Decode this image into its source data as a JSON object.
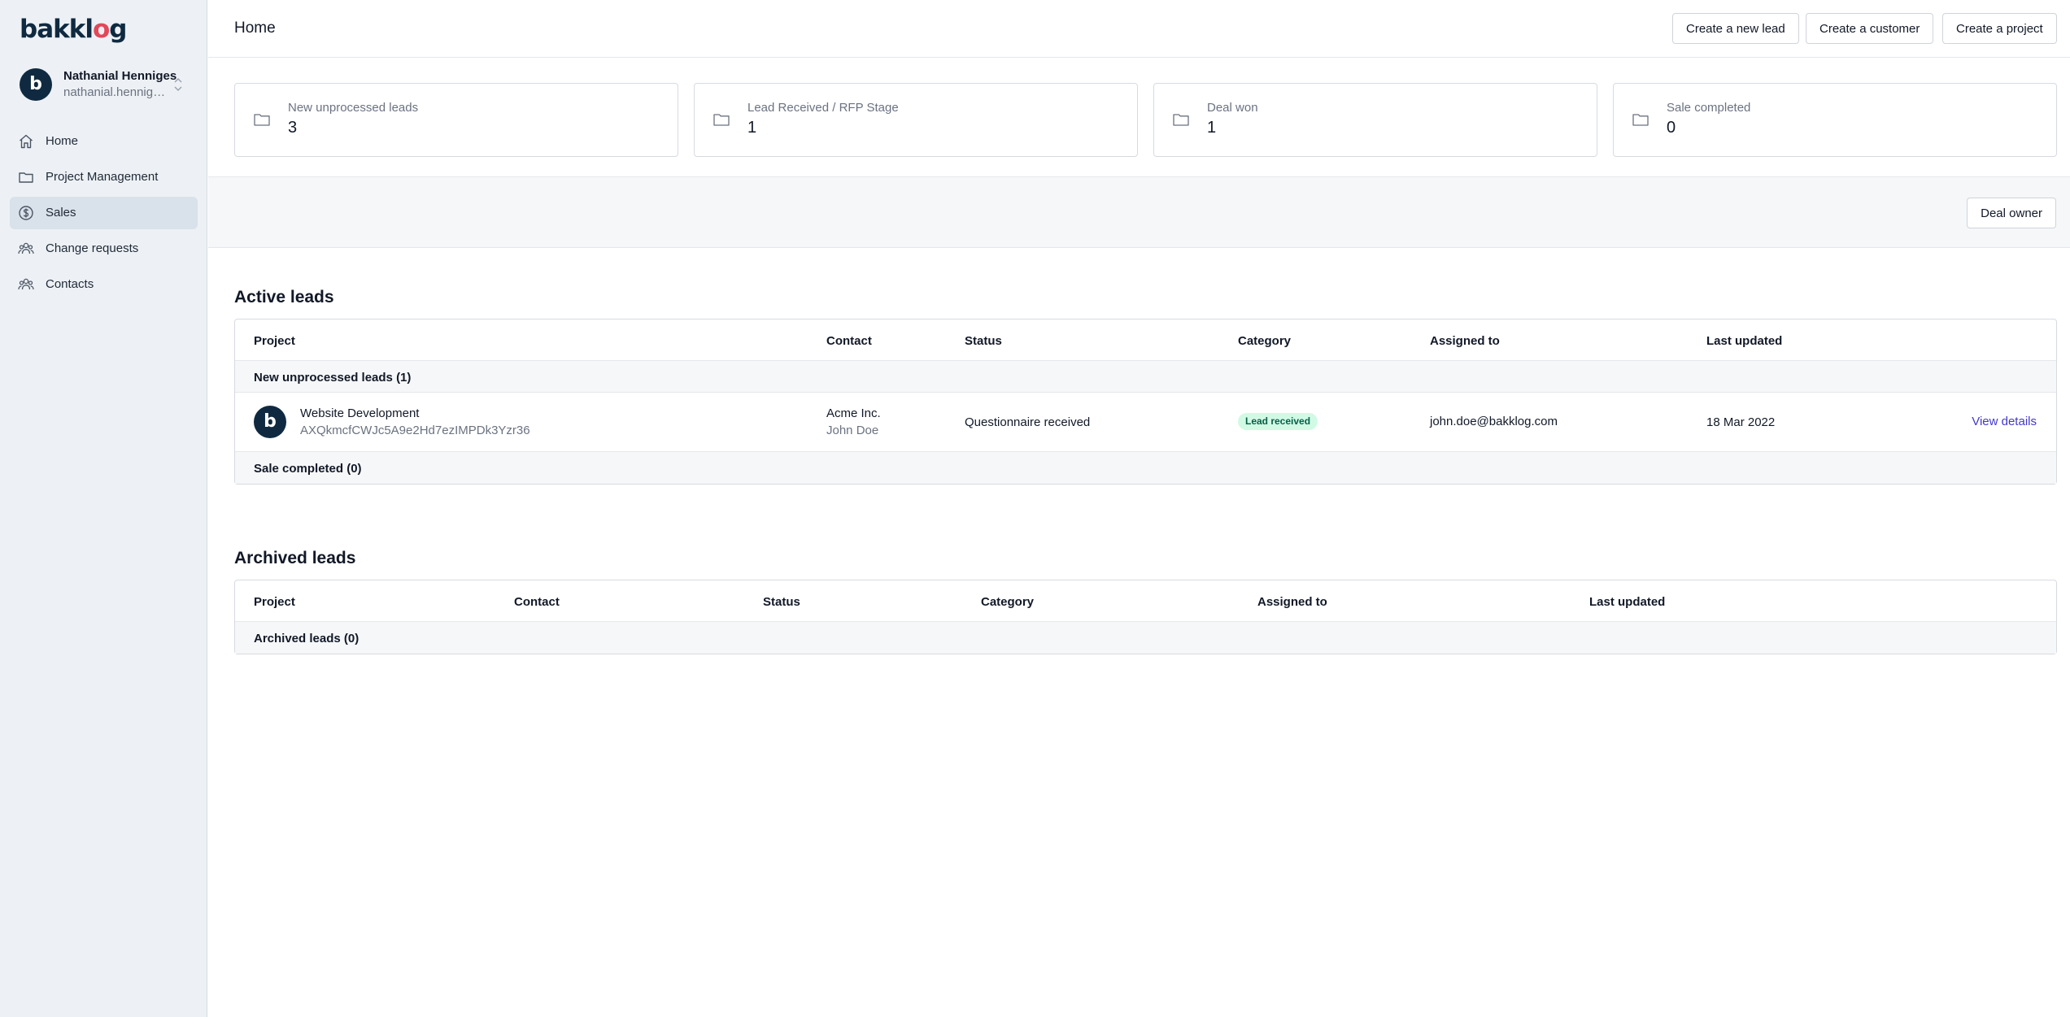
{
  "app": {
    "logo_prefix": "bakkl",
    "logo_accent": "o",
    "logo_suffix": "g",
    "avatar_letter": "b"
  },
  "user": {
    "name": "Nathanial Henniges",
    "email": "nathanial.henniges@bakklog.com"
  },
  "sidebar": {
    "items": [
      {
        "label": "Home",
        "icon": "home-icon",
        "active": false
      },
      {
        "label": "Project Management",
        "icon": "folder-icon",
        "active": false
      },
      {
        "label": "Sales",
        "icon": "dollar-icon",
        "active": true
      },
      {
        "label": "Change requests",
        "icon": "users-icon",
        "active": false
      },
      {
        "label": "Contacts",
        "icon": "users-icon",
        "active": false
      }
    ]
  },
  "header": {
    "title": "Home",
    "buttons": {
      "new_lead": "Create a new lead",
      "new_customer": "Create a customer",
      "new_project": "Create a project"
    }
  },
  "stats": [
    {
      "label": "New unprocessed leads",
      "value": "3"
    },
    {
      "label": "Lead Received / RFP Stage",
      "value": "1"
    },
    {
      "label": "Deal won",
      "value": "1"
    },
    {
      "label": "Sale completed",
      "value": "0"
    }
  ],
  "filter": {
    "deal_owner": "Deal owner"
  },
  "active_leads": {
    "title": "Active leads",
    "columns": [
      "Project",
      "Contact",
      "Status",
      "Category",
      "Assigned to",
      "Last updated"
    ],
    "groups": [
      {
        "label": "New unprocessed leads (1)"
      },
      {
        "label": "Sale completed (0)"
      }
    ],
    "rows": [
      {
        "project": "Website Development",
        "project_id": "AXQkmcfCWJc5A9e2Hd7ezIMPDk3Yzr36",
        "company": "Acme Inc.",
        "contact": "John Doe",
        "status": "Questionnaire received",
        "category": "Lead received",
        "assigned_to": "john.doe@bakklog.com",
        "last_updated": "18 Mar 2022",
        "action": "View details"
      }
    ]
  },
  "archived_leads": {
    "title": "Archived leads",
    "columns": [
      "Project",
      "Contact",
      "Status",
      "Category",
      "Assigned to",
      "Last updated"
    ],
    "groups": [
      {
        "label": "Archived leads (0)"
      }
    ]
  },
  "colors": {
    "sidebar_bg": "#edf1f5",
    "brand_dark": "#0f2a40",
    "brand_accent": "#e2475a",
    "link": "#4338ca",
    "badge_bg": "#d1fae5",
    "badge_text": "#065f46"
  }
}
